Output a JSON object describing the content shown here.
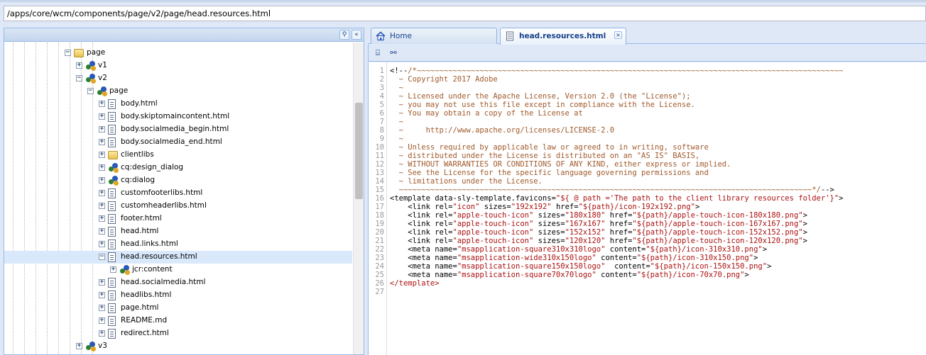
{
  "path_bar": {
    "value": "/apps/core/wcm/components/page/v2/page/head.resources.html"
  },
  "tree": {
    "header_buttons": {
      "search": "⚲",
      "collapse": "«"
    },
    "rows": [
      {
        "label": "page",
        "icon": "folder-icon",
        "expander": "−"
      },
      {
        "label": "v1",
        "icon": "node-icon",
        "expander": "+"
      },
      {
        "label": "v2",
        "icon": "node-icon",
        "expander": "−"
      },
      {
        "label": "page",
        "icon": "node-icon",
        "expander": "−"
      },
      {
        "label": "body.html",
        "icon": "file-icon",
        "expander": "+"
      },
      {
        "label": "body.skiptomaincontent.html",
        "icon": "file-icon",
        "expander": "+"
      },
      {
        "label": "body.socialmedia_begin.html",
        "icon": "file-icon",
        "expander": "+"
      },
      {
        "label": "body.socialmedia_end.html",
        "icon": "file-icon",
        "expander": "+"
      },
      {
        "label": "clientlibs",
        "icon": "folder-icon",
        "expander": "+"
      },
      {
        "label": "cq:design_dialog",
        "icon": "node-icon",
        "expander": "+"
      },
      {
        "label": "cq:dialog",
        "icon": "node-icon",
        "expander": "+"
      },
      {
        "label": "customfooterlibs.html",
        "icon": "file-icon",
        "expander": "+"
      },
      {
        "label": "customheaderlibs.html",
        "icon": "file-icon",
        "expander": "+"
      },
      {
        "label": "footer.html",
        "icon": "file-icon",
        "expander": "+"
      },
      {
        "label": "head.html",
        "icon": "file-icon",
        "expander": "+"
      },
      {
        "label": "head.links.html",
        "icon": "file-icon",
        "expander": "+"
      },
      {
        "label": "head.resources.html",
        "icon": "file-icon",
        "expander": "−",
        "selected": true
      },
      {
        "label": "jcr:content",
        "icon": "node-icon",
        "expander": "+"
      },
      {
        "label": "head.socialmedia.html",
        "icon": "file-icon",
        "expander": "+"
      },
      {
        "label": "headlibs.html",
        "icon": "file-icon",
        "expander": "+"
      },
      {
        "label": "page.html",
        "icon": "file-icon",
        "expander": "+"
      },
      {
        "label": "README.md",
        "icon": "file-icon",
        "expander": "+"
      },
      {
        "label": "redirect.html",
        "icon": "file-icon",
        "expander": "+"
      },
      {
        "label": "v3",
        "icon": "node-icon",
        "expander": "+"
      }
    ]
  },
  "tabs": [
    {
      "label": "Home",
      "icon": "home-icon",
      "active": false
    },
    {
      "label": "head.resources.html",
      "icon": "file-icon",
      "active": true,
      "close": "×"
    }
  ],
  "editor_toolbar": {
    "outline_icon": "⌸",
    "find_icon": "⚯"
  },
  "code": {
    "line_numbers": [
      "1",
      "2",
      "3",
      "4",
      "5",
      "6",
      "7",
      "8",
      "9",
      "10",
      "11",
      "12",
      "13",
      "14",
      "15",
      "16",
      "17",
      "18",
      "19",
      "20",
      "21",
      "22",
      "23",
      "24",
      "25",
      "26",
      "27"
    ],
    "lines": [
      [
        [
          "c-tag",
          "<!--"
        ],
        [
          "c-comment",
          "/*~~~~~~~~~~~~~~~~~~~~~~~~~~~~~~~~~~~~~~~~~~~~~~~~~~~~~~~~~~~~~~~~~~~~~~~~~~~~~~~~~~~~~~~~~~~~~~~"
        ]
      ],
      [
        [
          "c-comment",
          "  ~ Copyright 2017 Adobe"
        ]
      ],
      [
        [
          "c-comment",
          "  ~"
        ]
      ],
      [
        [
          "c-comment",
          "  ~ Licensed under the Apache License, Version 2.0 (the \"License\");"
        ]
      ],
      [
        [
          "c-comment",
          "  ~ you may not use this file except in compliance with the License."
        ]
      ],
      [
        [
          "c-comment",
          "  ~ You may obtain a copy of the License at"
        ]
      ],
      [
        [
          "c-comment",
          "  ~"
        ]
      ],
      [
        [
          "c-comment",
          "  ~     http://www.apache.org/licenses/LICENSE-2.0"
        ]
      ],
      [
        [
          "c-comment",
          "  ~"
        ]
      ],
      [
        [
          "c-comment",
          "  ~ Unless required by applicable law or agreed to in writing, software"
        ]
      ],
      [
        [
          "c-comment",
          "  ~ distributed under the License is distributed on an \"AS IS\" BASIS,"
        ]
      ],
      [
        [
          "c-comment",
          "  ~ WITHOUT WARRANTIES OR CONDITIONS OF ANY KIND, either express or implied."
        ]
      ],
      [
        [
          "c-comment",
          "  ~ See the License for the specific language governing permissions and"
        ]
      ],
      [
        [
          "c-comment",
          "  ~ limitations under the License."
        ]
      ],
      [
        [
          "c-comment",
          "  ~~~~~~~~~~~~~~~~~~~~~~~~~~~~~~~~~~~~~~~~~~~~~~~~~~~~~~~~~~~~~~~~~~~~~~~~~~~~~~~~~~~~~~~~~~~~*/"
        ],
        [
          "c-tag",
          "-->"
        ]
      ],
      [
        [
          "c-tag",
          "<template data-sly-template.favicons="
        ],
        [
          "c-str",
          "\"${ @ path ='The path to the client library resources folder'}\""
        ],
        [
          "c-tag",
          ">"
        ]
      ],
      [
        [
          "c-tag",
          "    <link rel="
        ],
        [
          "c-str",
          "\"icon\""
        ],
        [
          "c-tag",
          " sizes="
        ],
        [
          "c-str",
          "\"192x192\""
        ],
        [
          "c-tag",
          " href="
        ],
        [
          "c-str",
          "\"${path}/icon-192x192.png\""
        ],
        [
          "c-tag",
          ">"
        ]
      ],
      [
        [
          "c-tag",
          "    <link rel="
        ],
        [
          "c-str",
          "\"apple-touch-icon\""
        ],
        [
          "c-tag",
          " sizes="
        ],
        [
          "c-str",
          "\"180x180\""
        ],
        [
          "c-tag",
          " href="
        ],
        [
          "c-str",
          "\"${path}/apple-touch-icon-180x180.png\""
        ],
        [
          "c-tag",
          ">"
        ]
      ],
      [
        [
          "c-tag",
          "    <link rel="
        ],
        [
          "c-str",
          "\"apple-touch-icon\""
        ],
        [
          "c-tag",
          " sizes="
        ],
        [
          "c-str",
          "\"167x167\""
        ],
        [
          "c-tag",
          " href="
        ],
        [
          "c-str",
          "\"${path}/apple-touch-icon-167x167.png\""
        ],
        [
          "c-tag",
          ">"
        ]
      ],
      [
        [
          "c-tag",
          "    <link rel="
        ],
        [
          "c-str",
          "\"apple-touch-icon\""
        ],
        [
          "c-tag",
          " sizes="
        ],
        [
          "c-str",
          "\"152x152\""
        ],
        [
          "c-tag",
          " href="
        ],
        [
          "c-str",
          "\"${path}/apple-touch-icon-152x152.png\""
        ],
        [
          "c-tag",
          ">"
        ]
      ],
      [
        [
          "c-tag",
          "    <link rel="
        ],
        [
          "c-str",
          "\"apple-touch-icon\""
        ],
        [
          "c-tag",
          " sizes="
        ],
        [
          "c-str",
          "\"120x120\""
        ],
        [
          "c-tag",
          " href="
        ],
        [
          "c-str",
          "\"${path}/apple-touch-icon-120x120.png\""
        ],
        [
          "c-tag",
          ">"
        ]
      ],
      [
        [
          "c-tag",
          "    <meta name="
        ],
        [
          "c-str",
          "\"msapplication-square310x310logo\""
        ],
        [
          "c-tag",
          " content="
        ],
        [
          "c-str",
          "\"${path}/icon-310x310.png\""
        ],
        [
          "c-tag",
          ">"
        ]
      ],
      [
        [
          "c-tag",
          "    <meta name="
        ],
        [
          "c-str",
          "\"msapplication-wide310x150logo\""
        ],
        [
          "c-tag",
          " content="
        ],
        [
          "c-str",
          "\"${path}/icon-310x150.png\""
        ],
        [
          "c-tag",
          ">"
        ]
      ],
      [
        [
          "c-tag",
          "    <meta name="
        ],
        [
          "c-str",
          "\"msapplication-square150x150logo\""
        ],
        [
          "c-tag",
          "  content="
        ],
        [
          "c-str",
          "\"${path}/icon-150x150.png\""
        ],
        [
          "c-tag",
          ">"
        ]
      ],
      [
        [
          "c-tag",
          "    <meta name="
        ],
        [
          "c-str",
          "\"msapplication-square70x70logo\""
        ],
        [
          "c-tag",
          " content="
        ],
        [
          "c-str",
          "\"${path}/icon-70x70.png\""
        ],
        [
          "c-tag",
          ">"
        ]
      ],
      [
        [
          "c-kw",
          "</template>"
        ]
      ],
      []
    ]
  },
  "colors": {
    "panel_bg": "#dfe8f6",
    "border": "#99bbe8",
    "selected_row": "#d9e8fb",
    "comment": "#a05a2c",
    "string": "#a11"
  }
}
